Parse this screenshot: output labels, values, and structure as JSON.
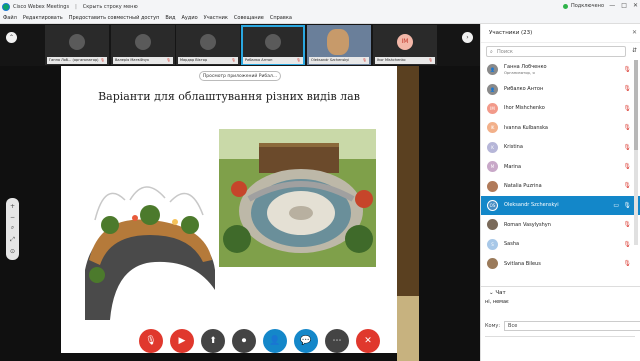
{
  "app": {
    "title": "Cisco Webex Meetings",
    "hide_menu": "Скрыть строку меню",
    "status": "Подключено",
    "window_controls": [
      "—",
      "□",
      "✕"
    ]
  },
  "menu": [
    "Файл",
    "Редактировать",
    "Предоставить совместный доступ",
    "Вид",
    "Аудио",
    "Участник",
    "Совещание",
    "Справка"
  ],
  "thumbnails": [
    {
      "name": "Ганна Лоб... (организатор)"
    },
    {
      "name": "Валерія Матвійчук"
    },
    {
      "name": "Мардар Віктор"
    },
    {
      "name": "Рибалко Антон"
    },
    {
      "name": "Oleksandr Szchenskyi"
    },
    {
      "name": "Ihor Mishchenko",
      "initials": "IM"
    }
  ],
  "viewer_label": "Просмотр приложений Рибал...",
  "slide": {
    "title": "Варіанти для облаштування різних видів лав"
  },
  "zoom_tools": [
    "+",
    "−",
    "⌕",
    "⤢",
    "⊙"
  ],
  "controls": [
    {
      "name": "mute",
      "icon": "🎙",
      "color": "red"
    },
    {
      "name": "video",
      "icon": "▶",
      "color": "red"
    },
    {
      "name": "share",
      "icon": "⬆",
      "color": "gray"
    },
    {
      "name": "record",
      "icon": "⏺",
      "color": "gray"
    },
    {
      "name": "participants",
      "icon": "👤",
      "color": "blue"
    },
    {
      "name": "chat",
      "icon": "💬",
      "color": "blue"
    },
    {
      "name": "more",
      "icon": "⋯",
      "color": "gray"
    },
    {
      "name": "leave",
      "icon": "✕",
      "color": "red"
    }
  ],
  "panel": {
    "title": "Участники (23)",
    "search_placeholder": "Поиск",
    "participants": [
      {
        "name": "Ганна Лобченко",
        "sub": "Организатор, я",
        "initials": "",
        "color": "#8a8a8a"
      },
      {
        "name": "Рибалко Антон",
        "sub": "",
        "initials": "",
        "color": "#8a8a8a"
      },
      {
        "name": "Ihor Mishchenko",
        "sub": "",
        "initials": "IM",
        "color": "#f29a8a"
      },
      {
        "name": "Ivanna Kulbanska",
        "sub": "",
        "initials": "IK",
        "color": "#f2b08a"
      },
      {
        "name": "Kristina",
        "sub": "",
        "initials": "K",
        "color": "#b6b6d8"
      },
      {
        "name": "Marina",
        "sub": "",
        "initials": "M",
        "color": "#c8a8c8"
      },
      {
        "name": "Natalia Puzrina",
        "sub": "",
        "initials": "",
        "color": "#b07a5a"
      },
      {
        "name": "Oleksandr Szchenskyi",
        "sub": "",
        "initials": "OS",
        "color": "#4a8fc4"
      },
      {
        "name": "Roman Vasylyshyn",
        "sub": "",
        "initials": "",
        "color": "#7a6a5a"
      },
      {
        "name": "Sasha",
        "sub": "",
        "initials": "S",
        "color": "#a8c8e8"
      },
      {
        "name": "Svitlana Bileus",
        "sub": "",
        "initials": "",
        "color": "#9a7a5a"
      }
    ],
    "chat_title": "Чат",
    "chat_message": "ні, немає",
    "chat_to_label": "Кому:",
    "chat_to_value": "Все"
  }
}
